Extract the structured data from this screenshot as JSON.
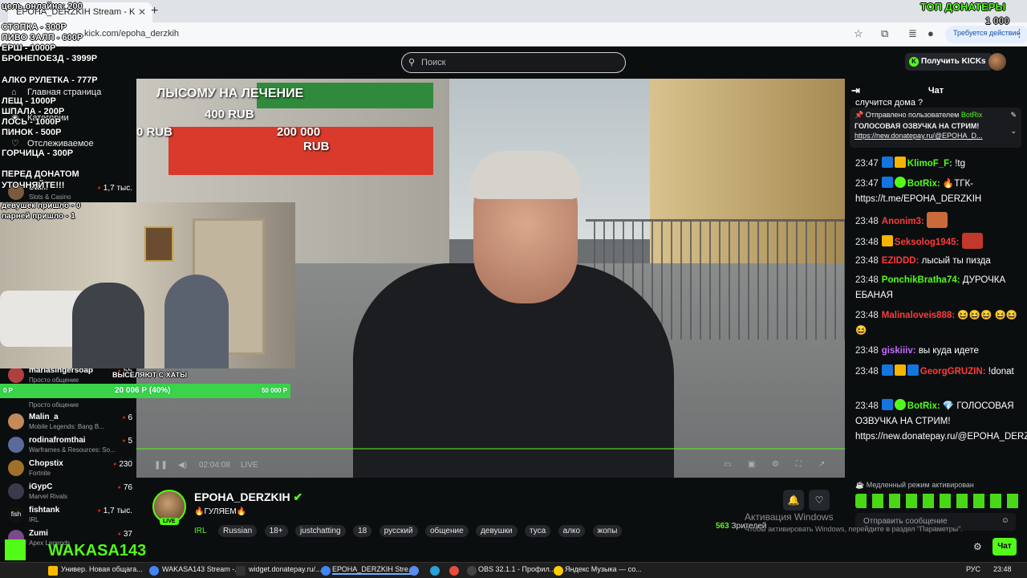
{
  "browser": {
    "tab_title": "ЕРОНА_DERZKIH Stream - K",
    "url": "kick.com/epoha_derzkih",
    "update_label": "Требуется действие"
  },
  "header": {
    "search_placeholder": "Поиск",
    "kicks_label": "Получить KICKs"
  },
  "overlay": {
    "online_goal": "цель онлайна: 200",
    "prices": [
      "СТОПКА - 300Р",
      "ПИВО ЗАЛП - 600Р",
      "ЕРШ - 1000Р",
      "БРОНЕПОЕЗД - 3999Р",
      "АЛКО РУЛЕТКА - 777Р",
      "ЛЕЩ - 1000Р",
      "ШПАЛА - 200Р",
      "ЛОСЬ - 1000Р",
      "ПИНОК - 500Р",
      "ГОРЧИЦА - 300Р"
    ],
    "warning_1": "ПЕРЕД ДОНАТОМ",
    "warning_2": "УТОЧНЯЙТЕ!!!",
    "girls": "девушек пришло - 0",
    "guys": "парней пришло - 1",
    "top_donors": "ТОП ДОНАТЕРЫ",
    "top_donor_amount": "1 000",
    "goal_left": "0 Р",
    "goal_mid": "20 006 Р (40%)",
    "goal_right": "50 000 Р",
    "webcam_caption": "ВЫСЕЛЯЮТ С ХАТЫ",
    "video_banner": "ЛЫСОМУ НА ЛЕЧЕНИЕ",
    "video_amount_1": "400 RUB",
    "video_amount_2": "200 000",
    "video_amount_2b": "RUB",
    "video_amount_3": "0 RUB",
    "wakasa": "WAKASA143"
  },
  "sidebar": {
    "home": "Главная страница",
    "browse": "Категории",
    "following": "Отслеживаемое",
    "channels": [
      {
        "name": "Sta...",
        "category": "Slots & Casino",
        "count": "1,7 тыс."
      },
      {
        "name": "mariasingersoap",
        "category": "Просто общение",
        "count": "55"
      },
      {
        "name": "Malin_a",
        "category": "Mobile Legends: Bang B...",
        "count": "6"
      },
      {
        "name": "rodinafromthai",
        "category": "Warframes & Resources: So...",
        "count": "5"
      },
      {
        "name": "Chopstix",
        "category": "Fortnite",
        "count": "230"
      },
      {
        "name": "iGypC",
        "category": "Marvel Rivals",
        "count": "76"
      },
      {
        "name": "fishtank",
        "category": "IRL",
        "count": "1,7 тыс."
      },
      {
        "name": "Zumi",
        "category": "Apex Legends",
        "count": "37"
      }
    ],
    "simple_talk": "Просто общение"
  },
  "stream": {
    "channel": "ЕРОНА_DERZKIH",
    "title": "🔥ГУЛЯЕМ🔥",
    "category": "IRL",
    "live": "LIVE",
    "tags": [
      "Russian",
      "18+",
      "justchatting",
      "18",
      "русский",
      "общение",
      "девушки",
      "туса",
      "алко",
      "жопы"
    ],
    "viewers": "563",
    "viewers_label": "Зрителей",
    "time": "02:04:08"
  },
  "chat": {
    "title": "Чат",
    "top_text": "случится дома ?",
    "pinned_by": "Отправлено пользователем",
    "pinned_user": "BotRix",
    "pinned_line1": "ГОЛОСОВАЯ ОЗВУЧКА НА СТРИМ!",
    "pinned_line2": "https://new.donatepay.ru/@EPOHA_D...",
    "messages": [
      {
        "time": "23:47",
        "user": "KlimoF_F:",
        "color": "#53fc18",
        "text": "!tg",
        "badges": "bg"
      },
      {
        "time": "23:47",
        "user": "BotRix:",
        "color": "#53fc18",
        "text": "🔥ТГК- https://t.me/EPOHA_DERZKIH",
        "badges": "bv"
      },
      {
        "time": "23:48",
        "user": "Anonim3:",
        "color": "#ff3b3b",
        "text": "",
        "badges": "e"
      },
      {
        "time": "23:48",
        "user": "Seksolog1945:",
        "color": "#ff3b3b",
        "text": "",
        "badges": "ge"
      },
      {
        "time": "23:48",
        "user": "EZIDDD:",
        "color": "#ff3b3b",
        "text": "лысый ты пизда",
        "badges": ""
      },
      {
        "time": "23:48",
        "user": "PonchikBratha74:",
        "color": "#53fc18",
        "text": "ДУРОЧКА ЕБАНАЯ",
        "badges": ""
      },
      {
        "time": "23:48",
        "user": "Malinaloveis888:",
        "color": "#ff3b3b",
        "text": "😆😆😆 😆😆😆",
        "badges": ""
      },
      {
        "time": "23:48",
        "user": "giskiiiv:",
        "color": "#c36cff",
        "text": "вы куда идете",
        "badges": ""
      },
      {
        "time": "23:48",
        "user": "GeorgGRUZIN:",
        "color": "#ff3b3b",
        "text": "!donat",
        "badges": "bgb"
      },
      {
        "time": "23:48",
        "user": "BotRix:",
        "color": "#53fc18",
        "text": "💎 ГОЛОСОВАЯ ОЗВУЧКА НА СТРИМ! https://new.donatepay.ru/@EPOHA_DERZKIH",
        "badges": "bv"
      }
    ],
    "slow_mode": "Медленный режим активирован",
    "input_placeholder": "Отправить сообщение",
    "send_label": "Чат"
  },
  "windows": {
    "activation_title": "Активация Windows",
    "activation_sub": "Чтобы активировать Windows, перейдите в раздел \"Параметры\".",
    "taskbar": [
      "Универ. Новая общага...",
      "WAKASA143 Stream -...",
      "widget.donatepay.ru/...",
      "ЕРОНА_DERZKIH Stre...",
      "OBS 32.1.1 - Профил...",
      "Яндекс Музыка — со..."
    ],
    "lang": "РУС",
    "clock": "23:48"
  }
}
